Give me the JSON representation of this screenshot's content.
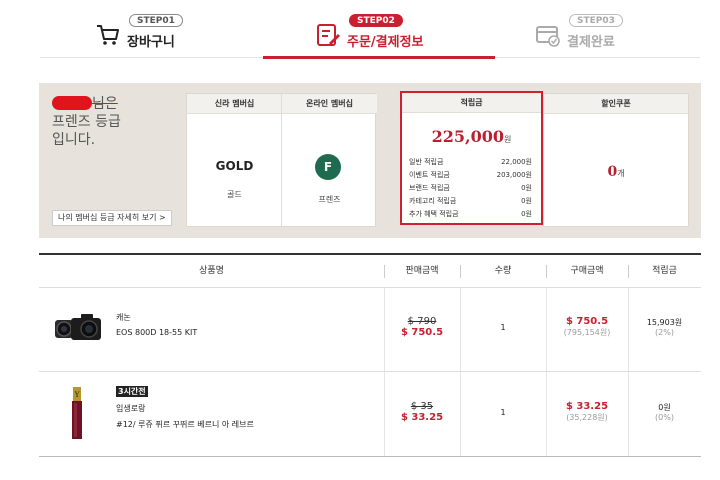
{
  "steps": [
    {
      "badge": "STEP01",
      "label": "장바구니",
      "icon": "cart-icon"
    },
    {
      "badge": "STEP02",
      "label": "주문/결제정보",
      "icon": "order-form-icon"
    },
    {
      "badge": "STEP03",
      "label": "결제완료",
      "icon": "payment-done-icon"
    }
  ],
  "greeting": {
    "suffix": "님은",
    "line2": "프렌즈 등급",
    "line3": "입니다."
  },
  "membership_detail_link": "나의 멤버십 등급 자세히 보기 >",
  "membership": {
    "shilla_header": "신라 멤버십",
    "shilla_grade": "GOLD",
    "shilla_grade_ko": "골드",
    "online_header": "온라인 멤버십",
    "online_letter": "F",
    "online_grade_ko": "프렌즈"
  },
  "points": {
    "header": "적립금",
    "total": "225,000",
    "unit": "원",
    "rows": [
      {
        "label": "일반 적립금",
        "value": "22,000원"
      },
      {
        "label": "이벤트 적립금",
        "value": "203,000원"
      },
      {
        "label": "브랜드 적립금",
        "value": "0원"
      },
      {
        "label": "카테고리 적립금",
        "value": "0원"
      },
      {
        "label": "추가 혜택 적립금",
        "value": "0원"
      }
    ]
  },
  "coupon": {
    "header": "할인쿠폰",
    "count": "0",
    "unit": "개"
  },
  "table": {
    "headers": [
      "상품명",
      "판매금액",
      "수량",
      "구매금액",
      "적립금"
    ],
    "rows": [
      {
        "brand": "캐논",
        "name": "EOS 800D 18-55 KIT",
        "tag": "",
        "old_price": "$ 790",
        "sale_price": "$ 750.5",
        "qty": "1",
        "pay_price": "$ 750.5",
        "pay_krw": "(795,154원)",
        "reward": "15,903원",
        "reward_rate": "(2%)"
      },
      {
        "brand": "입생로랑",
        "name": "#12/ 루쥬 퓌르 꾸뛰르 베르니 아 레브르",
        "tag": "3시간전",
        "old_price": "$ 35",
        "sale_price": "$ 33.25",
        "qty": "1",
        "pay_price": "$ 33.25",
        "pay_krw": "(35,228원)",
        "reward": "0원",
        "reward_rate": "(0%)"
      }
    ]
  },
  "colors": {
    "accent": "#c8202f",
    "panel_bg": "#e7e3dc",
    "highlight_border": "#d0202f",
    "membership_badge": "#1e6b4f"
  }
}
